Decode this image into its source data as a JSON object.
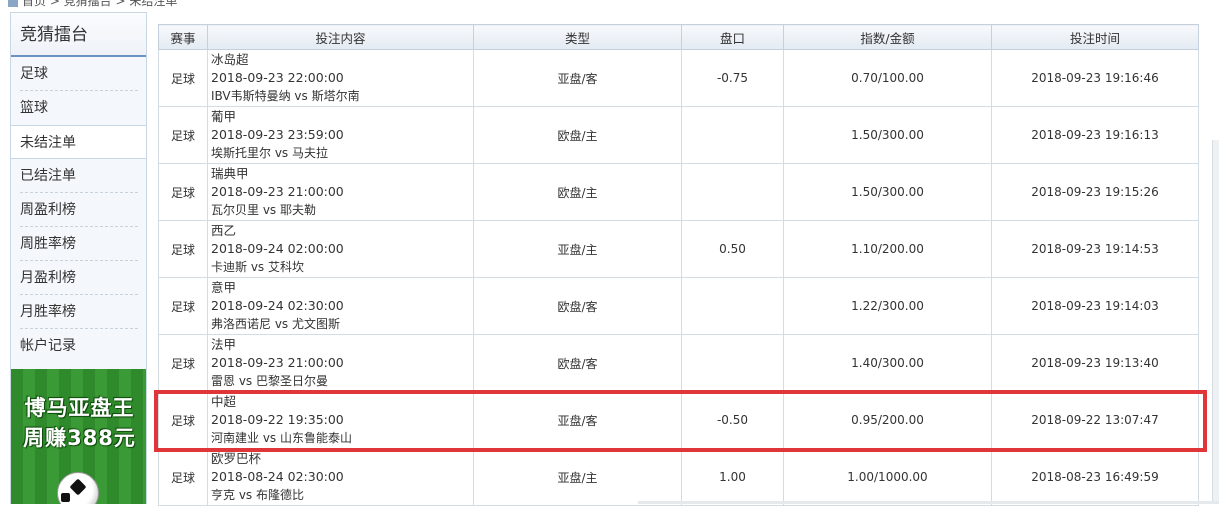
{
  "breadcrumb": {
    "text": "首页 > 竞猜擂台 > 未结注单"
  },
  "sidebar": {
    "title": "竞猜擂台",
    "items": [
      {
        "label": "足球"
      },
      {
        "label": "篮球"
      },
      {
        "label": "未结注单",
        "active": true
      },
      {
        "label": "已结注单"
      },
      {
        "label": "周盈利榜"
      },
      {
        "label": "周胜率榜"
      },
      {
        "label": "月盈利榜"
      },
      {
        "label": "月胜率榜"
      },
      {
        "label": "帐户记录"
      }
    ],
    "promo": {
      "line1": "博马亚盘王",
      "line2": "周赚388元"
    }
  },
  "table": {
    "headers": [
      "赛事",
      "投注内容",
      "类型",
      "盘口",
      "指数/金额",
      "投注时间"
    ],
    "rows": [
      {
        "event": "足球",
        "league": "冰岛超",
        "match_time": "2018-09-23 22:00:00",
        "teams": "IBV韦斯特曼纳 vs 斯塔尔南",
        "type": "亚盘/客",
        "handicap": "-0.75",
        "odds_amount": "0.70/100.00",
        "bet_time": "2018-09-23 19:16:46"
      },
      {
        "event": "足球",
        "league": "葡甲",
        "match_time": "2018-09-23 23:59:00",
        "teams": "埃斯托里尔 vs 马夫拉",
        "type": "欧盘/主",
        "handicap": "",
        "odds_amount": "1.50/300.00",
        "bet_time": "2018-09-23 19:16:13"
      },
      {
        "event": "足球",
        "league": "瑞典甲",
        "match_time": "2018-09-23 21:00:00",
        "teams": "瓦尔贝里 vs 耶夫勒",
        "type": "欧盘/主",
        "handicap": "",
        "odds_amount": "1.50/300.00",
        "bet_time": "2018-09-23 19:15:26"
      },
      {
        "event": "足球",
        "league": "西乙",
        "match_time": "2018-09-24 02:00:00",
        "teams": "卡迪斯 vs 艾科坎",
        "type": "亚盘/主",
        "handicap": "0.50",
        "odds_amount": "1.10/200.00",
        "bet_time": "2018-09-23 19:14:53"
      },
      {
        "event": "足球",
        "league": "意甲",
        "match_time": "2018-09-24 02:30:00",
        "teams": "弗洛西诺尼 vs 尤文图斯",
        "type": "欧盘/客",
        "handicap": "",
        "odds_amount": "1.22/300.00",
        "bet_time": "2018-09-23 19:14:03"
      },
      {
        "event": "足球",
        "league": "法甲",
        "match_time": "2018-09-23 21:00:00",
        "teams": "雷恩 vs 巴黎圣日尔曼",
        "type": "欧盘/客",
        "handicap": "",
        "odds_amount": "1.40/300.00",
        "bet_time": "2018-09-23 19:13:40"
      },
      {
        "event": "足球",
        "league": "中超",
        "match_time": "2018-09-22 19:35:00",
        "teams": "河南建业 vs 山东鲁能泰山",
        "type": "亚盘/客",
        "handicap": "-0.50",
        "odds_amount": "0.95/200.00",
        "bet_time": "2018-09-22 13:07:47"
      },
      {
        "event": "足球",
        "league": "欧罗巴杯",
        "match_time": "2018-08-24 02:30:00",
        "teams": "亨克 vs 布隆德比",
        "type": "亚盘/主",
        "handicap": "1.00",
        "odds_amount": "1.00/1000.00",
        "bet_time": "2018-08-23 16:49:59"
      }
    ]
  },
  "colors": {
    "highlight": "#e0363a",
    "sidebar_accent": "#6a93c4"
  }
}
